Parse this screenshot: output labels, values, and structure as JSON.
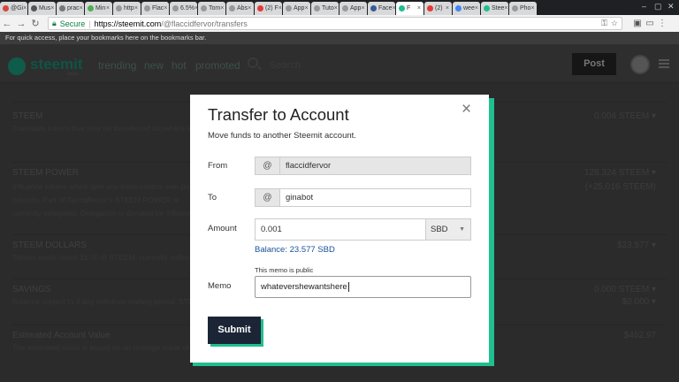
{
  "browser": {
    "tabs": [
      {
        "label": "@Gi",
        "color": "#db4437"
      },
      {
        "label": "Mus",
        "color": "#555555"
      },
      {
        "label": "prac",
        "color": "#777777"
      },
      {
        "label": "Min",
        "color": "#4caf50"
      },
      {
        "label": "http",
        "color": "#999999"
      },
      {
        "label": "Flac",
        "color": "#999999"
      },
      {
        "label": "6.5%",
        "color": "#999999"
      },
      {
        "label": "Tom",
        "color": "#999999"
      },
      {
        "label": "Abs",
        "color": "#999999"
      },
      {
        "label": "(2) F",
        "color": "#e53935"
      },
      {
        "label": "App",
        "color": "#999999"
      },
      {
        "label": "Tuto",
        "color": "#999999"
      },
      {
        "label": "App",
        "color": "#999999"
      },
      {
        "label": "Face",
        "color": "#3b5998"
      },
      {
        "label": "F",
        "color": "#1fbf8f"
      },
      {
        "label": "(2)",
        "color": "#e53935"
      },
      {
        "label": "wee",
        "color": "#4285f4"
      },
      {
        "label": "Stee",
        "color": "#1fbf8f"
      },
      {
        "label": "Pho",
        "color": "#999999"
      }
    ],
    "secure_label": "Secure",
    "url_host": "https://steemit.com",
    "url_path": "/@flaccidfervor/transfers",
    "bookmarks_hint": "For quick access, place your bookmarks here on the bookmarks bar."
  },
  "header": {
    "logo": "steemit",
    "logo_sub": "beta",
    "nav": [
      "trending",
      "new",
      "hot",
      "promoted"
    ],
    "search_placeholder": "Search",
    "post_label": "Post"
  },
  "wallet": {
    "rows": [
      {
        "title": "STEEM",
        "desc": "Tradeable tokens that may be transferred anywhere at anytime. Steem can be converted to STEEM POWER in a process",
        "value": "0.004 STEEM ▾",
        "value2": ""
      },
      {
        "title": "STEEM POWER",
        "desc": "Influence tokens which give you more control over post payouts. Part of flaccidfervor's STEEM POWER is currently delegated. Delegation is donated for influence or to help new users perform actions on steemit. Your delegation amount can fluctuate.",
        "value": "128.324 STEEM ▾",
        "value2": "(+25.016 STEEM)"
      },
      {
        "title": "STEEM DOLLARS",
        "desc": "Tokens worth about $1.00 of STEEM, currently collecting 0% APR.",
        "value": "$23.577 ▾",
        "value2": ""
      },
      {
        "title": "SAVINGS",
        "desc": "Balance subject to 3 day withdraw waiting period. STEEM",
        "value": "0.000 STEEM ▾",
        "value2": "$0.000 ▾"
      },
      {
        "title": "Estimated Account Value",
        "desc": "The estimated value is based on an average value of STEEM in US dollars.",
        "value": "$462.97",
        "value2": ""
      }
    ]
  },
  "modal": {
    "title": "Transfer to Account",
    "subtitle": "Move funds to another Steemit account.",
    "from_label": "From",
    "from_value": "flaccidfervor",
    "to_label": "To",
    "to_value": "ginabot",
    "at_symbol": "@",
    "amount_label": "Amount",
    "amount_value": "0.001",
    "currency": "SBD",
    "currency_arrow": "▼",
    "balance": "Balance: 23.577 SBD",
    "memo_label": "Memo",
    "memo_note": "This memo is public",
    "memo_value": "whatevershewantshere",
    "submit_label": "Submit",
    "close_symbol": "×"
  },
  "colors": {
    "accent": "#1fbf8f",
    "submit_bg": "#1b2535",
    "link": "#1a5099"
  }
}
